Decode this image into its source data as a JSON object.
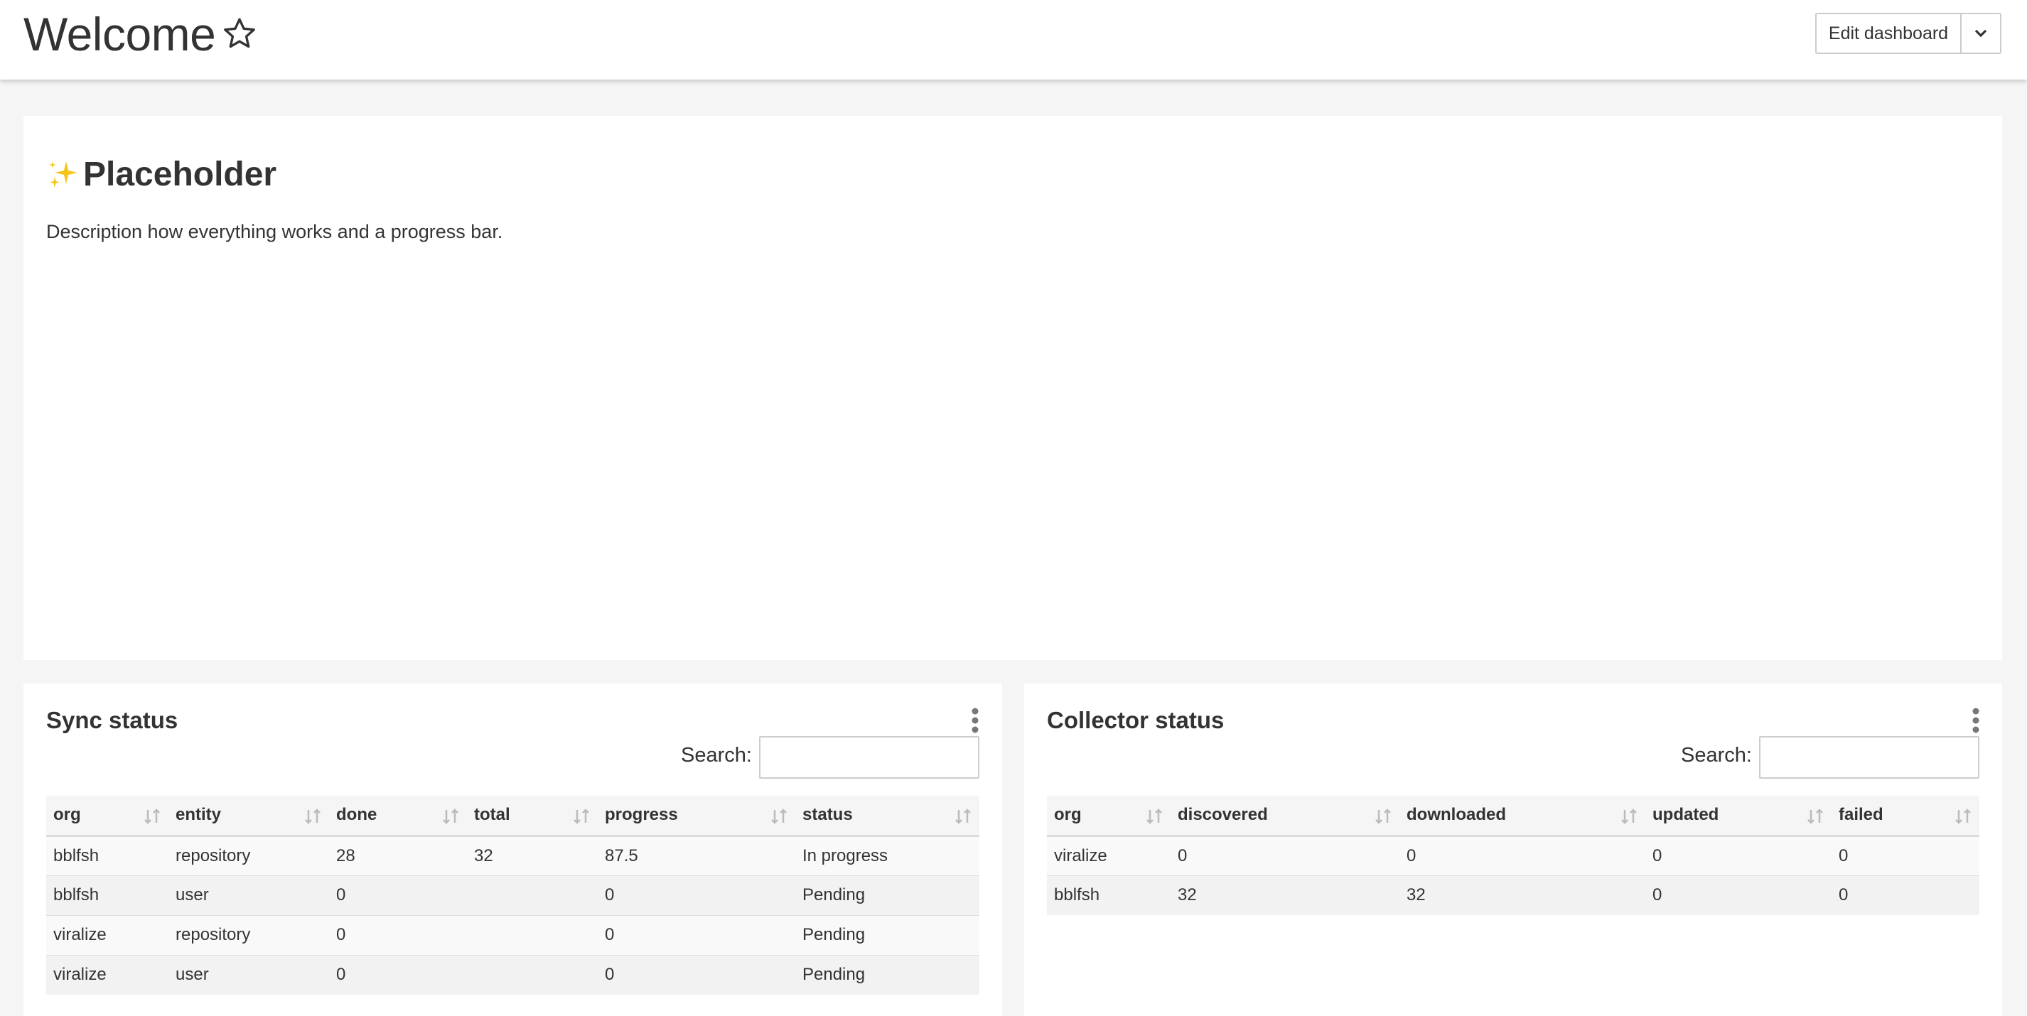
{
  "header": {
    "title": "Welcome",
    "edit_label": "Edit dashboard",
    "star_icon": "star-outline-icon",
    "caret_icon": "chevron-down-icon"
  },
  "placeholder": {
    "title": "Placeholder",
    "icon": "sparkles-icon",
    "description": "Description how everything works and a progress bar."
  },
  "sync": {
    "title": "Sync status",
    "search_label": "Search:",
    "search_value": "",
    "columns": [
      "org",
      "entity",
      "done",
      "total",
      "progress",
      "status"
    ],
    "rows": [
      [
        "bblfsh",
        "repository",
        "28",
        "32",
        "87.5",
        "In progress"
      ],
      [
        "bblfsh",
        "user",
        "0",
        "",
        "0",
        "Pending"
      ],
      [
        "viralize",
        "repository",
        "0",
        "",
        "0",
        "Pending"
      ],
      [
        "viralize",
        "user",
        "0",
        "",
        "0",
        "Pending"
      ]
    ]
  },
  "collector": {
    "title": "Collector status",
    "search_label": "Search:",
    "search_value": "",
    "columns": [
      "org",
      "discovered",
      "downloaded",
      "updated",
      "failed"
    ],
    "rows": [
      [
        "viralize",
        "0",
        "0",
        "0",
        "0"
      ],
      [
        "bblfsh",
        "32",
        "32",
        "0",
        "0"
      ]
    ]
  },
  "colors": {
    "header_bg": "#ffffff",
    "page_bg": "#f5f5f5",
    "text": "#333333",
    "sort_icon": "#bbbbbb",
    "sparkle": "#f5c518"
  }
}
